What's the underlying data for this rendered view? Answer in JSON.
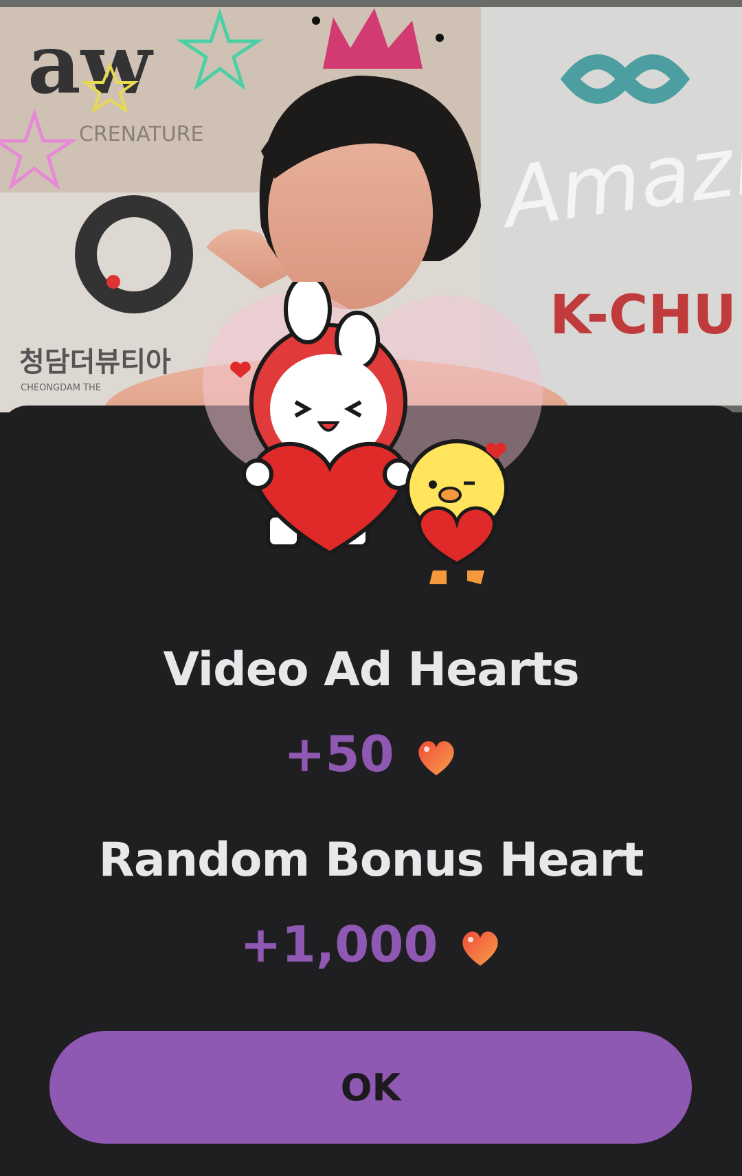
{
  "background": {
    "logo_text": "aw",
    "brand_text": "CRENATURE",
    "korean_text": "청담더뷰티아",
    "korean_sub": "CHEONGDAM THE",
    "amazing_text": "Amazing",
    "kchu_text": "K-CHU"
  },
  "rewards": [
    {
      "title": "Video Ad Hearts",
      "amount": "+50"
    },
    {
      "title": "Random Bonus Heart",
      "amount": "+1,000"
    }
  ],
  "ok_label": "OK",
  "colors": {
    "accent": "#8f58b3",
    "sheet": "#1f1e20",
    "heart": "#f25c3a"
  }
}
